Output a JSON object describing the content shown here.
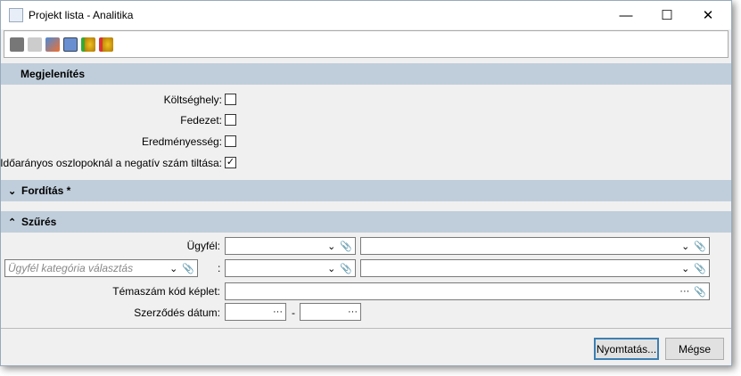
{
  "window": {
    "title": "Projekt lista - Analitika",
    "minimize": "—",
    "maximize": "☐",
    "close": "✕"
  },
  "toolbar": {
    "icons": [
      "print-icon",
      "print-preview-icon",
      "edit-icon",
      "calculator-icon",
      "db-import-icon",
      "db-export-icon"
    ]
  },
  "sections": {
    "display": {
      "title": "Megjelenítés",
      "options": [
        {
          "label": "Költséghely:",
          "checked": false
        },
        {
          "label": "Fedezet:",
          "checked": false
        },
        {
          "label": "Eredményesség:",
          "checked": false
        },
        {
          "label": "Időarányos oszlopoknál a negatív szám tiltása:",
          "checked": true
        }
      ]
    },
    "translation": {
      "title": "Fordítás *",
      "chev": "⌄"
    },
    "filter": {
      "title": "Szűrés",
      "chev": "⌃",
      "customer_label": "Ügyfél:",
      "category_placeholder": "Ügyfél kategória választás",
      "colon": ":",
      "topic_label": "Témaszám kód képlet:",
      "date_label": "Szerződés dátum:",
      "date_sep": "-"
    }
  },
  "glyphs": {
    "dropdown": "⌄",
    "clip": "📎",
    "ellipsis": "···",
    "check": "✓"
  },
  "footer": {
    "print": "Nyomtatás...",
    "cancel": "Mégse"
  }
}
